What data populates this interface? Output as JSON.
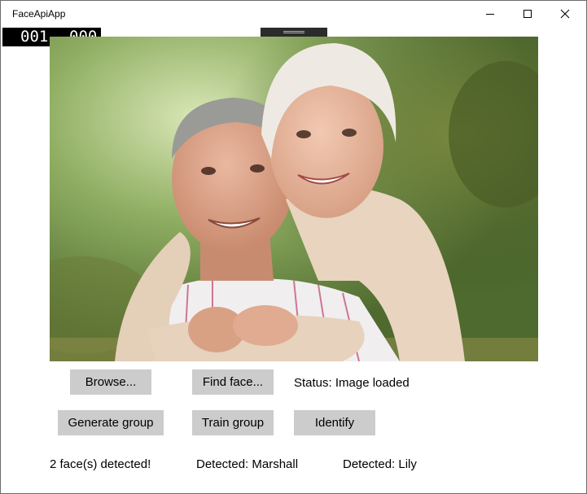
{
  "window": {
    "title": "FaceApiApp"
  },
  "debug_counter": {
    "left": "001",
    "right": "000"
  },
  "toolbar": {
    "browse_label": "Browse...",
    "find_face_label": "Find face...",
    "status_text": "Status: Image loaded",
    "generate_group_label": "Generate group",
    "train_group_label": "Train group",
    "identify_label": "Identify"
  },
  "results": {
    "faces_detected": "2 face(s) detected!",
    "detected_1": "Detected: Marshall",
    "detected_2": "Detected: Lily"
  },
  "colors": {
    "button_bg": "#cccccc",
    "window_bg": "#ffffff",
    "frame_counter_bg": "#000000"
  },
  "icons": [
    "minimize-icon",
    "maximize-icon",
    "close-icon"
  ]
}
